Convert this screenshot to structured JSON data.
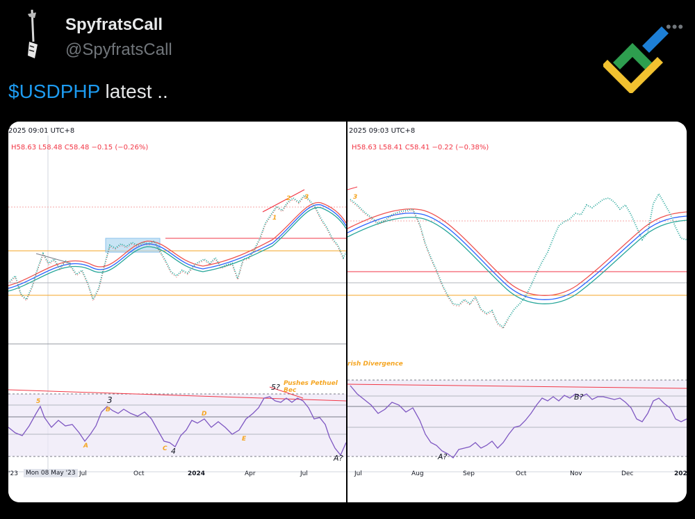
{
  "post": {
    "display_name": "SpyfratsCall",
    "handle": "@SpyfratsCall",
    "more": "•••",
    "text_cashtag": "$USDPHP",
    "text_rest": " latest .."
  },
  "logo": {
    "colors": [
      "#2e9e4f",
      "#1d7fd6",
      "#f2c230"
    ]
  },
  "left_chart": {
    "header": "2025 09:01 UTC+8",
    "ohlc": "H58.63  L58.48  C58.48  −0.15 (−0.26%)",
    "labels": {
      "w5": "5",
      "w3": "3",
      "wb": "B",
      "wa": "A",
      "wc": "C",
      "w4": "4",
      "wd": "D",
      "we": "E",
      "w1": "1",
      "w2": "2",
      "w3b": "3",
      "w5q": "5?",
      "aq": "A?",
      "note": "Pushes Pethuel Bec"
    },
    "x_ticks": [
      "'23",
      "Mon 08 May '23",
      "Jul",
      "Oct",
      "2024",
      "Apr",
      "Jul"
    ]
  },
  "right_chart": {
    "header": "2025 09:03 UTC+8",
    "ohlc": "H58.63  L58.41  C58.41  −0.22 (−0.38%)",
    "labels": {
      "w3": "3",
      "div": "rish Divergence",
      "aq": "A?",
      "bq": "B?"
    },
    "x_ticks": [
      "Jul",
      "Aug",
      "Sep",
      "Oct",
      "Nov",
      "Dec",
      "202"
    ]
  },
  "colors": {
    "up": "#26a69a",
    "down": "#ef5350",
    "rsi": "#7e57c2",
    "orange": "#f5a623",
    "cashtag": "#1d9bf0"
  }
}
